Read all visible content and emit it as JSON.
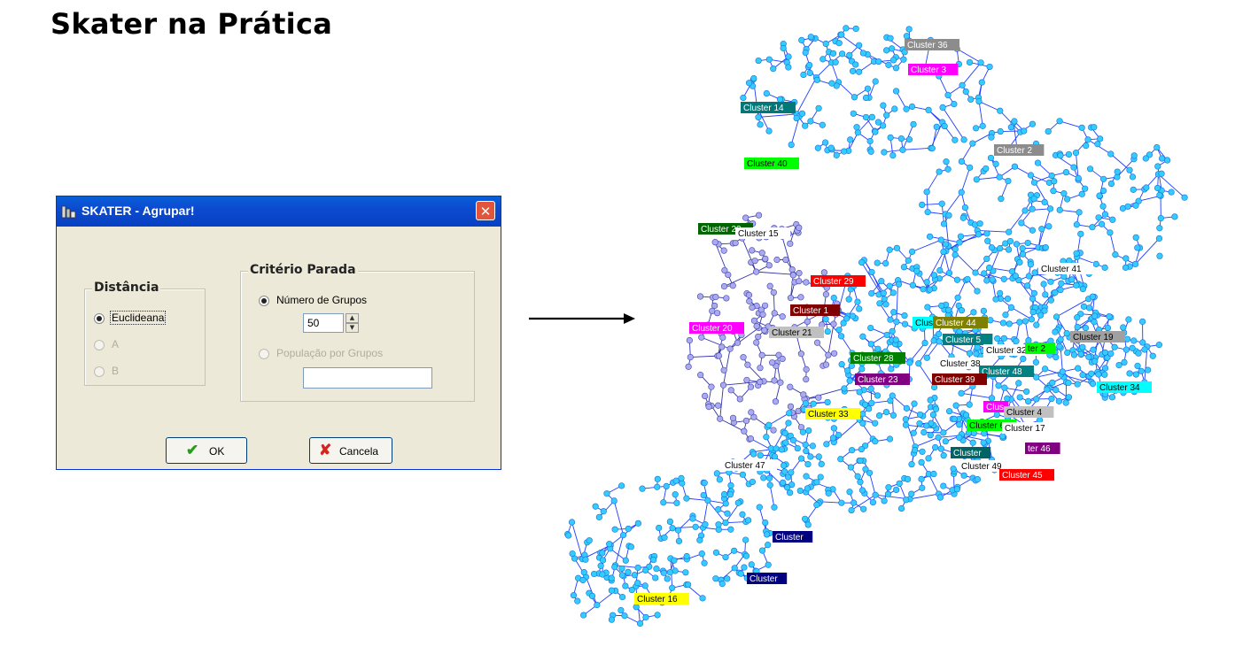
{
  "slide": {
    "title": "Skater na Prática"
  },
  "dialog": {
    "title": "SKATER - Agrupar!",
    "close_symbol": "✕",
    "distancia": {
      "legend": "Distância",
      "options": [
        {
          "label": "Euclideana",
          "checked": true,
          "enabled": true
        },
        {
          "label": "A",
          "checked": false,
          "enabled": false
        },
        {
          "label": "B",
          "checked": false,
          "enabled": false
        }
      ]
    },
    "criterio": {
      "legend": "Critério Parada",
      "numero_label": "Número de Grupos",
      "numero_value": "50",
      "populacao_label": "População por Grupos",
      "populacao_value": ""
    },
    "ok_label": "OK",
    "ok_icon": "check-icon",
    "cancel_label": "Cancela",
    "cancel_icon": "cross-icon"
  },
  "map": {
    "labels": [
      {
        "text": "Cluster 36",
        "bg": "#8c8c8c",
        "fg": "#ffffff"
      },
      {
        "text": "Cluster 3",
        "bg": "#ff00ff",
        "fg": "#ffffff"
      },
      {
        "text": "Cluster 14",
        "bg": "#007878",
        "fg": "#ffffff"
      },
      {
        "text": "Cluster 2",
        "bg": "#8c8c8c",
        "fg": "#ffffff"
      },
      {
        "text": "Cluster 40",
        "bg": "#00ff00",
        "fg": "#000000"
      },
      {
        "text": "Cluster 22",
        "bg": "#006400",
        "fg": "#ffffff"
      },
      {
        "text": "Cluster 15",
        "bg": "#ffffff",
        "fg": "#000000"
      },
      {
        "text": "Cluster 41",
        "bg": "#ffffff",
        "fg": "#000000"
      },
      {
        "text": "Cluster 29",
        "bg": "#ff0000",
        "fg": "#ffffff"
      },
      {
        "text": "Cluster 1",
        "bg": "#800000",
        "fg": "#ffffff"
      },
      {
        "text": "Cluster 20",
        "bg": "#ff00ff",
        "fg": "#ffffff"
      },
      {
        "text": "Cluster 21",
        "bg": "#c0c0c0",
        "fg": "#000000"
      },
      {
        "text": "Clus",
        "bg": "#00ffff",
        "fg": "#000000"
      },
      {
        "text": "Cluster 44",
        "bg": "#808000",
        "fg": "#ffffff"
      },
      {
        "text": "Cluster 5",
        "bg": "#008080",
        "fg": "#ffffff"
      },
      {
        "text": "Cluster 19",
        "bg": "#a0a0a0",
        "fg": "#000000"
      },
      {
        "text": "Cluster 32",
        "bg": "#ffffff",
        "fg": "#000000"
      },
      {
        "text": "ter 2",
        "bg": "#00ff00",
        "fg": "#000000"
      },
      {
        "text": "Cluster 28",
        "bg": "#008000",
        "fg": "#ffffff"
      },
      {
        "text": "Cluster 38",
        "bg": "#ffffff",
        "fg": "#000000"
      },
      {
        "text": "Cluster 48",
        "bg": "#008080",
        "fg": "#ffffff"
      },
      {
        "text": "Cluster 23",
        "bg": "#800080",
        "fg": "#ffffff"
      },
      {
        "text": "Cluster 39",
        "bg": "#800000",
        "fg": "#ffffff"
      },
      {
        "text": "Cluster 34",
        "bg": "#00ffff",
        "fg": "#000000"
      },
      {
        "text": "Cluster 33",
        "bg": "#ffff00",
        "fg": "#000000"
      },
      {
        "text": "Clus",
        "bg": "#ff00ff",
        "fg": "#ffffff"
      },
      {
        "text": "Cluster 4",
        "bg": "#c0c0c0",
        "fg": "#000000"
      },
      {
        "text": "Cluster 6",
        "bg": "#00ff00",
        "fg": "#000000"
      },
      {
        "text": "Cluster 17",
        "bg": "#ffffff",
        "fg": "#000000"
      },
      {
        "text": "Cluster 47",
        "bg": "#ffffff",
        "fg": "#000000"
      },
      {
        "text": "Cluster",
        "bg": "#006464",
        "fg": "#ffffff"
      },
      {
        "text": "Cluster 49",
        "bg": "#ffffff",
        "fg": "#000000"
      },
      {
        "text": "ter 46",
        "bg": "#800080",
        "fg": "#ffffff"
      },
      {
        "text": "Cluster 45",
        "bg": "#ff0000",
        "fg": "#ffffff"
      },
      {
        "text": "Cluster",
        "bg": "#000080",
        "fg": "#ffffff"
      },
      {
        "text": "Cluster",
        "bg": "#000080",
        "fg": "#ffffff"
      },
      {
        "text": "Cluster 16",
        "bg": "#ffff00",
        "fg": "#000000"
      }
    ],
    "node_color": "#33ccff",
    "edge_color": "#1e3cff",
    "alt_node_color": "#aaaaee",
    "alt_edge_color": "#3333aa"
  }
}
